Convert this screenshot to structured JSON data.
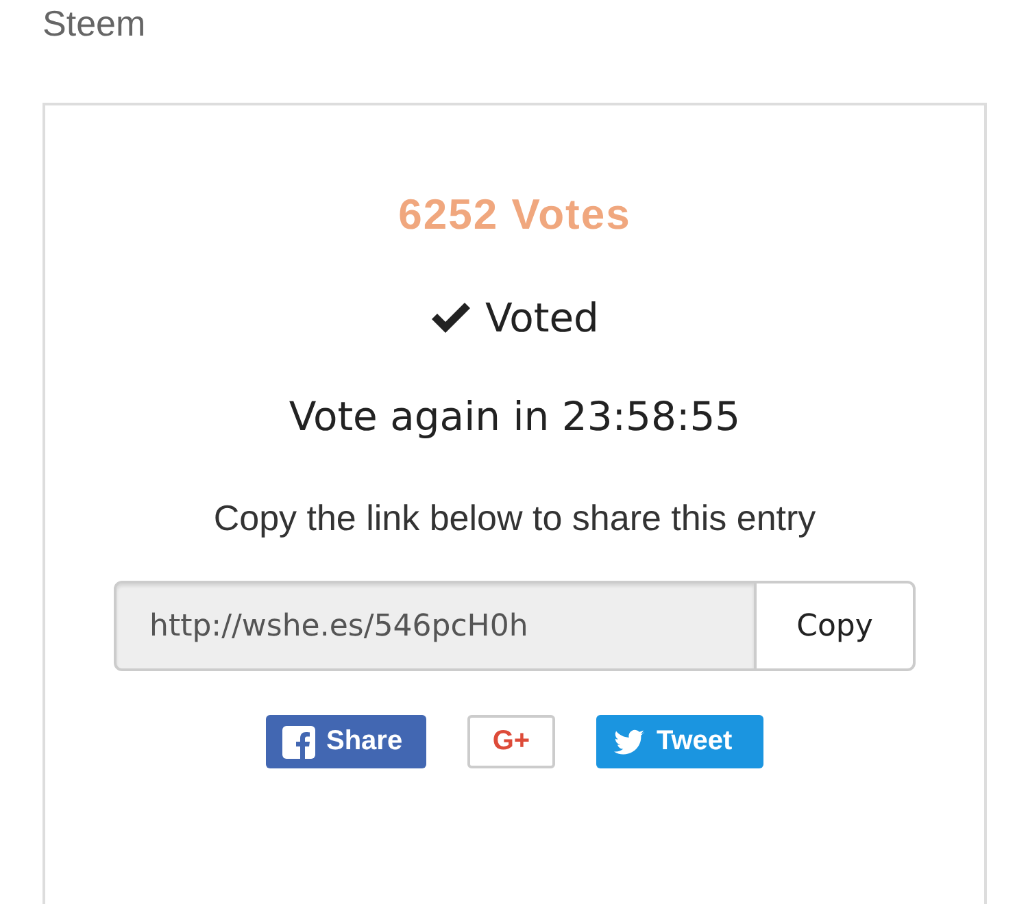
{
  "header": {
    "title": "Steem"
  },
  "card": {
    "votes": "6252 Votes",
    "voted": true,
    "voted_label": "Voted",
    "countdown": "Vote again in 23:58:55",
    "share_hint": "Copy the link below to share this entry",
    "link": {
      "value": "http://wshe.es/546pcH0h",
      "button": "Copy"
    },
    "social": [
      {
        "kind": "facebook",
        "label": "Share"
      },
      {
        "kind": "google",
        "label": "G+"
      },
      {
        "kind": "twitter",
        "label": "Tweet"
      }
    ]
  }
}
